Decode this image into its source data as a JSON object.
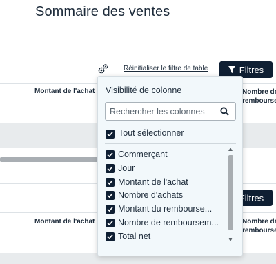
{
  "page": {
    "title": "Sommaire des ventes"
  },
  "toolbar": {
    "reset_label": "Réinitialiser le filtre de table",
    "filters_label": "Filtres",
    "gear_icon": "settings-gear-icon",
    "filter_icon": "funnel-icon"
  },
  "table": {
    "headers": {
      "purchase_amount": "Montant de l'achat",
      "refund_count": "Nombre de\nrembourse..."
    }
  },
  "column_visibility": {
    "title": "Visibilité de colonne",
    "search_placeholder": "Rechercher les colonnes",
    "search_value": "",
    "select_all_label": "Tout sélectionner",
    "select_all_checked": true,
    "columns": [
      {
        "label": "Commerçant",
        "checked": true
      },
      {
        "label": "Jour",
        "checked": true
      },
      {
        "label": "Montant de l'achat",
        "checked": true
      },
      {
        "label": "Nombre d'achats",
        "checked": true
      },
      {
        "label": "Montant du rembourse...",
        "checked": true
      },
      {
        "label": "Nombre de remboursem...",
        "checked": true
      },
      {
        "label": "Total net",
        "checked": true
      }
    ]
  },
  "colors": {
    "primary_dark": "#0f1f33",
    "popover_bg": "#f2f8fb",
    "band_gray": "#e8ebed"
  }
}
